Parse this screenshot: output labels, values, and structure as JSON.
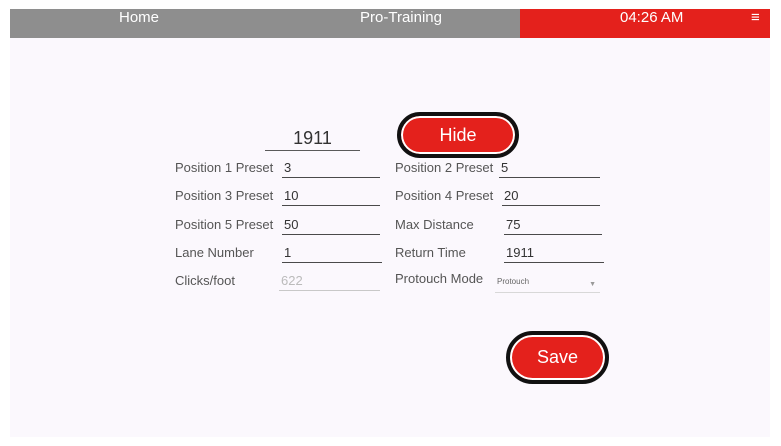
{
  "header": {
    "home_label": "Home",
    "title": "Pro-Training",
    "time": "04:26 AM",
    "menu_glyph": "≡"
  },
  "code_value": "1911",
  "buttons": {
    "hide_label": "Hide",
    "save_label": "Save"
  },
  "fields": {
    "position1_label": "Position 1 Preset",
    "position1_value": "3",
    "position2_label": "Position 2 Preset",
    "position2_value": "5",
    "position3_label": "Position 3 Preset",
    "position3_value": "10",
    "position4_label": "Position 4 Preset",
    "position4_value": "20",
    "position5_label": "Position 5 Preset",
    "position5_value": "50",
    "max_distance_label": "Max Distance",
    "max_distance_value": "75",
    "lane_number_label": "Lane Number",
    "lane_number_value": "1",
    "return_time_label": "Return Time",
    "return_time_value": "1911",
    "clicks_label": "Clicks/foot",
    "clicks_value": "622",
    "protouch_label": "Protouch Mode",
    "protouch_value": "Protouch"
  },
  "colors": {
    "accent_red": "#e4211c",
    "header_gray": "#8e8e8e",
    "background": "#fbf8fd"
  }
}
